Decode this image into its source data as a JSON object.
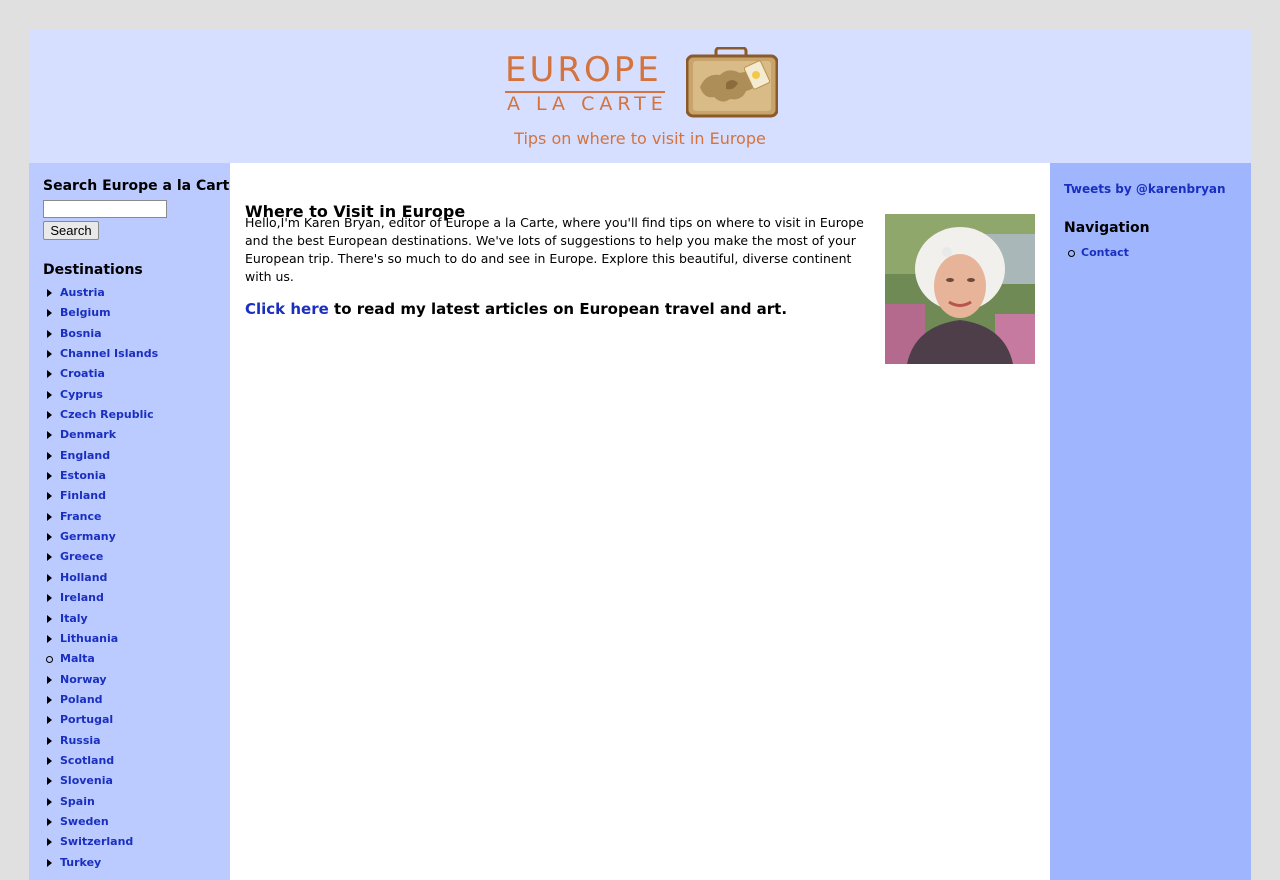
{
  "header": {
    "logo_line1": "EUROPE",
    "logo_line2": "A LA CARTE",
    "tagline": "Tips on where to visit in Europe"
  },
  "search": {
    "title": "Search Europe a la Carte",
    "input_value": "",
    "button_label": "Search"
  },
  "destinations": {
    "title": "Destinations",
    "items": [
      {
        "label": "Austria",
        "marker": "arrow"
      },
      {
        "label": "Belgium",
        "marker": "arrow"
      },
      {
        "label": "Bosnia",
        "marker": "arrow"
      },
      {
        "label": "Channel Islands",
        "marker": "arrow"
      },
      {
        "label": "Croatia",
        "marker": "arrow"
      },
      {
        "label": "Cyprus",
        "marker": "arrow"
      },
      {
        "label": "Czech Republic",
        "marker": "arrow"
      },
      {
        "label": "Denmark",
        "marker": "arrow"
      },
      {
        "label": "England",
        "marker": "arrow"
      },
      {
        "label": "Estonia",
        "marker": "arrow"
      },
      {
        "label": "Finland",
        "marker": "arrow"
      },
      {
        "label": "France",
        "marker": "arrow"
      },
      {
        "label": "Germany",
        "marker": "arrow"
      },
      {
        "label": "Greece",
        "marker": "arrow"
      },
      {
        "label": "Holland",
        "marker": "arrow"
      },
      {
        "label": "Ireland",
        "marker": "arrow"
      },
      {
        "label": "Italy",
        "marker": "arrow"
      },
      {
        "label": "Lithuania",
        "marker": "arrow"
      },
      {
        "label": "Malta",
        "marker": "circle"
      },
      {
        "label": "Norway",
        "marker": "arrow"
      },
      {
        "label": "Poland",
        "marker": "arrow"
      },
      {
        "label": "Portugal",
        "marker": "arrow"
      },
      {
        "label": "Russia",
        "marker": "arrow"
      },
      {
        "label": "Scotland",
        "marker": "arrow"
      },
      {
        "label": "Slovenia",
        "marker": "arrow"
      },
      {
        "label": "Spain",
        "marker": "arrow"
      },
      {
        "label": "Sweden",
        "marker": "arrow"
      },
      {
        "label": "Switzerland",
        "marker": "arrow"
      },
      {
        "label": "Turkey",
        "marker": "arrow"
      }
    ]
  },
  "main": {
    "title": "Where to Visit in Europe",
    "intro": "Hello,I'm Karen Bryan, editor of Europe a la Carte, where you'll find tips on where to visit in Europe and the best European destinations. We've lots of suggestions to help you make the most of your European trip. There's so much to do and see in Europe. Explore this beautiful, diverse continent with us.",
    "promo_link": "Click here",
    "promo_text": " to read my latest articles on European travel and art."
  },
  "right": {
    "tweets_link": "Tweets by @karenbryan",
    "nav_title": "Navigation",
    "nav_items": [
      "Contact"
    ]
  },
  "colors": {
    "accent": "#d4733d",
    "link": "#1a2fbf",
    "header_bg": "#d6dfff",
    "left_bg": "#bccbff",
    "right_bg": "#9fb6ff"
  }
}
